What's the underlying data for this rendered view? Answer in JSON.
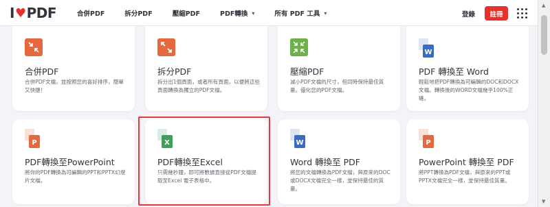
{
  "header": {
    "logo_text_left": "I",
    "logo_text_right": "PDF",
    "nav": [
      {
        "label": "合併PDF",
        "dropdown": false
      },
      {
        "label": "拆分PDF",
        "dropdown": false
      },
      {
        "label": "壓縮PDF",
        "dropdown": false
      },
      {
        "label": "PDF轉換",
        "dropdown": true
      },
      {
        "label": "所有 PDF 工具",
        "dropdown": true
      }
    ],
    "login_label": "登錄",
    "register_label": "註冊"
  },
  "tools": [
    {
      "title": "合併PDF",
      "description": "合併PDF文檔，並按照您的喜好排序，簡單又快捷！",
      "icon": "merge-icon",
      "color": "#e5683f"
    },
    {
      "title": "拆分PDF",
      "description": "拆分出1個頁面，或者所有頁面，以便將這些頁面轉換為獨立的PDF文檔。",
      "icon": "split-icon",
      "color": "#e5683f"
    },
    {
      "title": "壓縮PDF",
      "description": "減小PDF文檔的尺寸，但同時保持最佳質量。優化您的PDF文檔。",
      "icon": "compress-icon",
      "color": "#6eb04a"
    },
    {
      "title": "PDF 轉換至 Word",
      "description": "輕鬆地把PDF轉換為可編輯的DOC和DOCX文檔。轉換後的WORD文檔幾乎100%正確。",
      "icon": "word-icon",
      "color": "#3b6cc4"
    },
    {
      "title": "PDF轉換至PowerPoint",
      "description": "將你的PDF轉換為可編輯的PPT和PPTX幻燈片文檔。",
      "icon": "powerpoint-icon",
      "color": "#e5683f"
    },
    {
      "title": "PDF轉換至Excel",
      "description": "只需幾秒鐘，即可將數據直接從PDF文檔提取至Excel 電子表格中。",
      "icon": "excel-icon",
      "color": "#3f9f5b"
    },
    {
      "title": "Word 轉換至 PDF",
      "description": "將您的文檔轉換為PDF文檔，與原來的DOC或DOCX文檔完全一樣，並保持最佳的質量。",
      "icon": "word-icon",
      "color": "#3b6cc4"
    },
    {
      "title": "PowerPoint 轉換至 PDF",
      "description": "將PPT轉換為PDF文檔，與原來的PPT或PPTX文檔完全一樣，並保持最佳質量。",
      "icon": "powerpoint-icon",
      "color": "#e5683f"
    }
  ],
  "colors": {
    "brand_red": "#e5322d",
    "highlight": "#e03a3a"
  }
}
